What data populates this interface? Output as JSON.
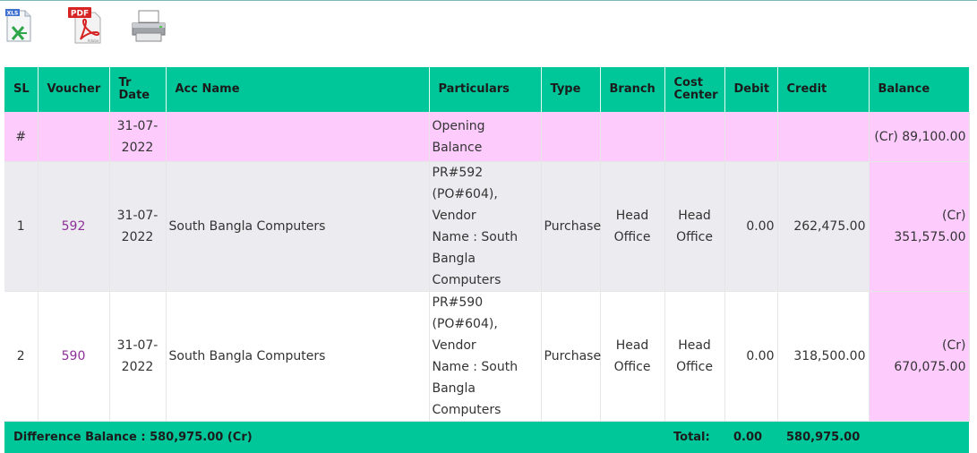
{
  "toolbar": {
    "xls_icon": "excel-export-icon",
    "xls_badge": "XLS",
    "pdf_icon": "pdf-export-icon",
    "pdf_badge": "PDF",
    "pdf_sub": "Adobe",
    "print_icon": "printer-icon"
  },
  "colors": {
    "header": "#00c79a",
    "balance_cell": "#fdccfd",
    "voucher_link": "#8e2f9a",
    "row_alt": "#ececf0"
  },
  "table": {
    "headers": {
      "sl": "SL",
      "voucher": "Voucher",
      "tr_date_1": "Tr",
      "tr_date_2": "Date",
      "acc_name": "Acc Name",
      "particulars": "Particulars",
      "type": "Type",
      "branch": "Branch",
      "cost_center_1": "Cost",
      "cost_center_2": "Center",
      "debit": "Debit",
      "credit": "Credit",
      "balance": "Balance"
    },
    "opening": {
      "sl": "#",
      "date_1": "31-07-",
      "date_2": "2022",
      "particulars": "Opening Balance",
      "balance": "(Cr) 89,100.00"
    },
    "rows": [
      {
        "sl": "1",
        "voucher": "592",
        "date_1": "31-07-",
        "date_2": "2022",
        "acc_name": "South Bangla Computers",
        "particulars": [
          "PR#592",
          "(PO#604), Vendor",
          "Name : South",
          "Bangla",
          "Computers"
        ],
        "type": "Purchase",
        "branch_1": "Head",
        "branch_2": "Office",
        "cost_center_1": "Head",
        "cost_center_2": "Office",
        "debit": "0.00",
        "credit": "262,475.00",
        "balance": "(Cr) 351,575.00"
      },
      {
        "sl": "2",
        "voucher": "590",
        "date_1": "31-07-",
        "date_2": "2022",
        "acc_name": "South Bangla Computers",
        "particulars": [
          "PR#590",
          "(PO#604), Vendor",
          "Name : South",
          "Bangla",
          "Computers"
        ],
        "type": "Purchase",
        "branch_1": "Head",
        "branch_2": "Office",
        "cost_center_1": "Head",
        "cost_center_2": "Office",
        "debit": "0.00",
        "credit": "318,500.00",
        "balance": "(Cr) 670,075.00"
      }
    ],
    "footer": {
      "difference": "Difference Balance : 580,975.00 (Cr)",
      "total_label": "Total:",
      "debit": "0.00",
      "credit": "580,975.00"
    }
  }
}
